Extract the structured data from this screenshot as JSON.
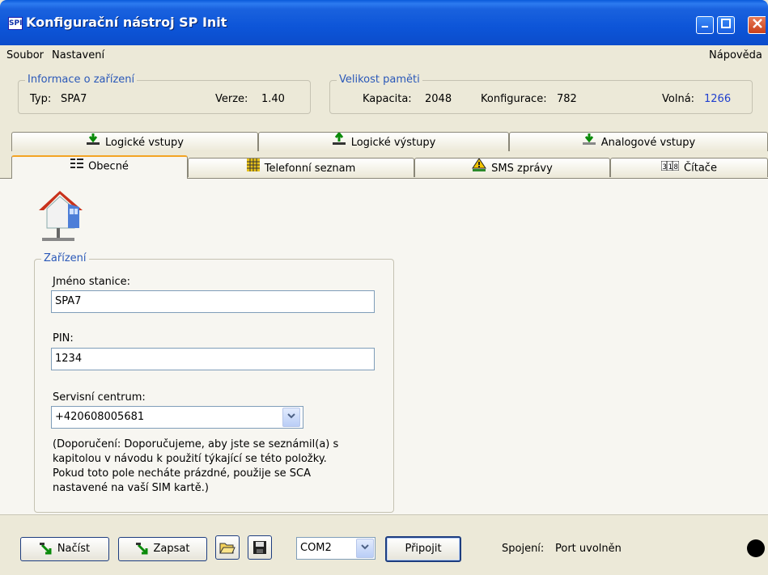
{
  "window": {
    "title": "Konfigurační nástroj SP Init",
    "app_icon": "spi-logo-icon"
  },
  "menu": {
    "file": "Soubor",
    "settings": "Nastavení",
    "help": "Nápověda"
  },
  "device_info": {
    "legend": "Informace o zařízení",
    "type_label": "Typ:",
    "type_value": "SPA7",
    "version_label": "Verze:",
    "version_value": "1.40"
  },
  "memory": {
    "legend": "Velikost paměti",
    "capacity_label": "Kapacita:",
    "capacity_value": "2048",
    "config_label": "Konfigurace:",
    "config_value": "782",
    "free_label": "Volná:",
    "free_value": "1266"
  },
  "tabs_top": [
    {
      "label": "Logické vstupy",
      "icon": "input-arrow-icon"
    },
    {
      "label": "Logické výstupy",
      "icon": "output-arrow-icon"
    },
    {
      "label": "Analogové vstupy",
      "icon": "analog-input-icon"
    }
  ],
  "tabs_bottom": [
    {
      "label": "Obecné",
      "icon": "general-list-icon",
      "active": true
    },
    {
      "label": "Telefonní seznam",
      "icon": "phonebook-grid-icon"
    },
    {
      "label": "SMS zprávy",
      "icon": "sms-warning-icon"
    },
    {
      "label": "Čítače",
      "icon": "counter-icon"
    }
  ],
  "device_group": {
    "legend": "Zařízení",
    "station_label": "Jméno stanice:",
    "station_value": "SPA7",
    "pin_label": "PIN:",
    "pin_value": "1234",
    "service_label": "Servisní centrum:",
    "service_value": "+420608005681",
    "hint_lines": [
      "(Doporučení: Doporučujeme, aby jste se seznámil(a) s",
      "kapitolou v návodu k použití týkající se této položky.",
      "Pokud toto pole necháte prázdné, použije se SCA",
      "nastavené na vaší SIM kartě.)"
    ]
  },
  "bottom": {
    "load_label": "Načíst",
    "write_label": "Zapsat",
    "port_value": "COM2",
    "connect_label": "Připojit",
    "connection_label": "Spojení:",
    "connection_value": "Port uvolněn"
  }
}
